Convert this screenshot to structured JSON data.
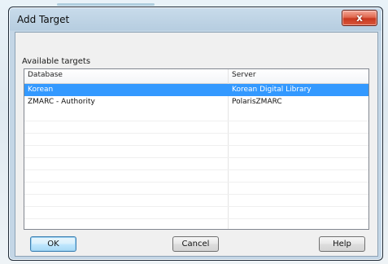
{
  "dialog": {
    "title": "Add Target",
    "close_label": "x"
  },
  "targets": {
    "label": "Available targets",
    "columns": [
      "Database",
      "Server"
    ],
    "rows": [
      {
        "database": "Korean",
        "server": "Korean Digital Library",
        "selected": true
      },
      {
        "database": "ZMARC - Authority",
        "server": "PolarisZMARC",
        "selected": false
      }
    ]
  },
  "buttons": {
    "ok": "OK",
    "cancel": "Cancel",
    "help": "Help"
  },
  "colors": {
    "selection": "#3399ff",
    "close_button": "#c8381f"
  }
}
